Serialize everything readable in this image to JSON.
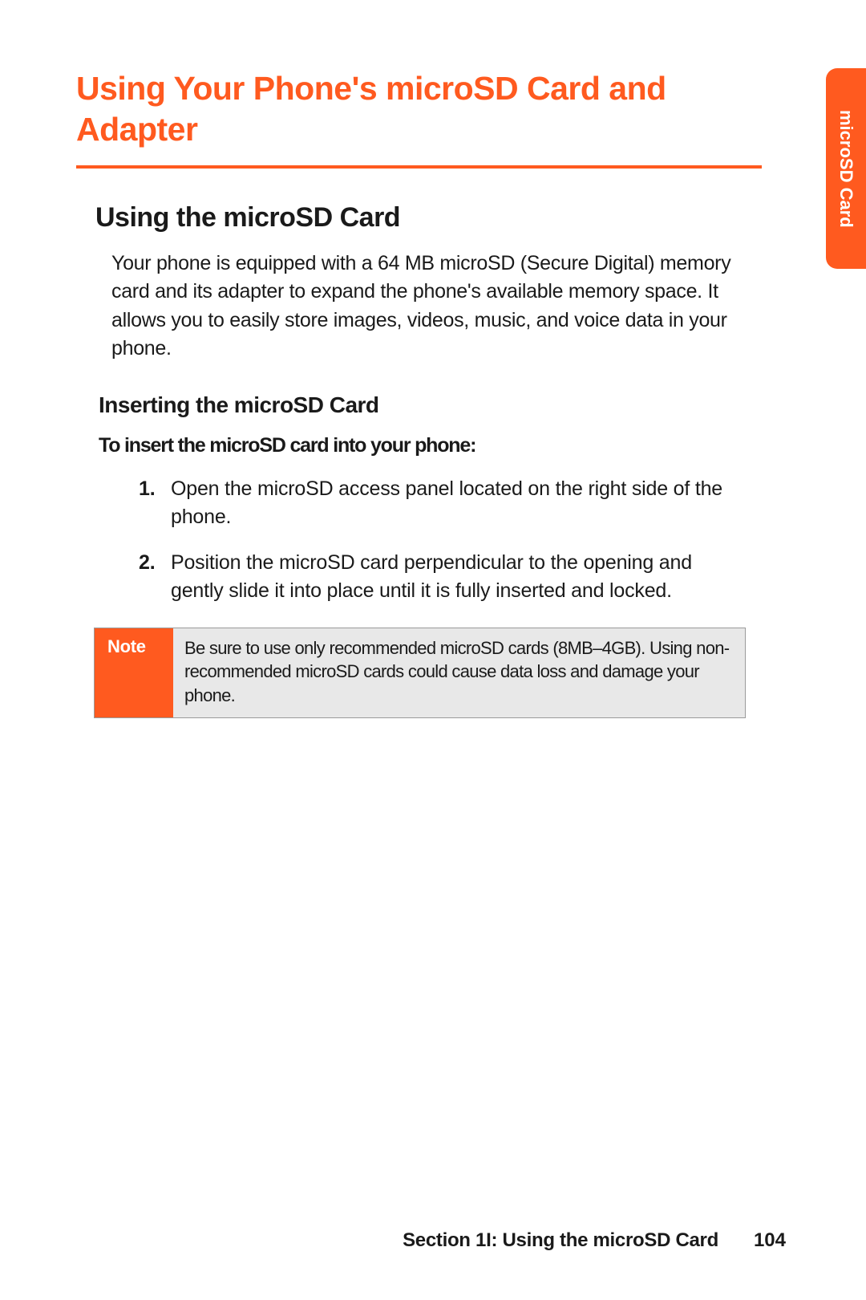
{
  "main_title": "Using Your Phone's microSD Card and Adapter",
  "section": {
    "title": "Using the microSD Card",
    "intro": "Your phone is equipped with a 64 MB microSD (Secure Digital) memory card and its adapter to expand the phone's available memory space. It allows you to easily store images, videos, music, and voice data in your phone.",
    "subsection": {
      "title": "Inserting the microSD Card",
      "lead": "To insert the microSD card into your phone:",
      "steps": [
        {
          "num": "1.",
          "text": "Open the microSD access panel located on the right side of the phone."
        },
        {
          "num": "2.",
          "text": "Position the microSD card perpendicular to the opening and gently slide it into place until it is fully inserted and locked."
        }
      ]
    },
    "note": {
      "label": "Note",
      "body": "Be sure to use only recommended microSD cards (8MB–4GB). Using non-recommended microSD cards could cause data loss and damage your phone."
    }
  },
  "side_tab": "microSD Card",
  "footer": {
    "section_label": "Section 1I: Using the microSD Card",
    "page": "104"
  }
}
